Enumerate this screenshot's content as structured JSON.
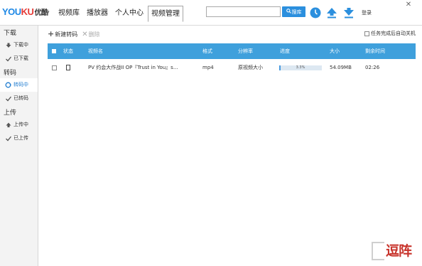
{
  "header": {
    "logo_you": "YOU",
    "logo_ku": "KU",
    "logo_cn": "优酷",
    "logo_caret": "▾",
    "nav": [
      {
        "label": "视频库"
      },
      {
        "label": "播放器"
      },
      {
        "label": "个人中心"
      },
      {
        "label": "视频管理",
        "active": true
      }
    ],
    "search": {
      "value": "",
      "placeholder": ""
    },
    "search_button_label": "搜库",
    "login_label": "登录",
    "close_label": "✕"
  },
  "sidebar": {
    "groups": [
      {
        "title": "下载",
        "items": [
          {
            "label": "下载中",
            "icon": "download-arrow-icon"
          },
          {
            "label": "已下载",
            "icon": "check-icon"
          }
        ]
      },
      {
        "title": "转码",
        "items": [
          {
            "label": "转码中",
            "icon": "convert-cycle-icon",
            "active": true
          },
          {
            "label": "已转码",
            "icon": "check-icon"
          }
        ]
      },
      {
        "title": "上传",
        "items": [
          {
            "label": "上传中",
            "icon": "upload-arrow-icon"
          },
          {
            "label": "已上传",
            "icon": "check-icon"
          }
        ]
      }
    ]
  },
  "toolbar": {
    "new_label": "新建转码",
    "delete_label": "删除",
    "auto_shutdown_label": "任务完成后自动关机",
    "auto_shutdown_checked": false
  },
  "table": {
    "columns": [
      "状态",
      "视频名",
      "格式",
      "分辨率",
      "进度",
      "大小",
      "剩余时间"
    ],
    "rows": [
      {
        "name": "PV 约会大作战II OP『Trust in You』s...",
        "format": "mp4",
        "resolution": "原视频大小",
        "progress_pct": 3.3,
        "progress_label": "3.3%",
        "size": "54.09MB",
        "remaining": "02:26"
      }
    ]
  },
  "colors": {
    "accent": "#3fa0dc",
    "brand_blue": "#1e88e5",
    "brand_red": "#e53935",
    "active_nav": "#1f7cd0"
  },
  "watermark": {
    "text": "逗阵"
  }
}
